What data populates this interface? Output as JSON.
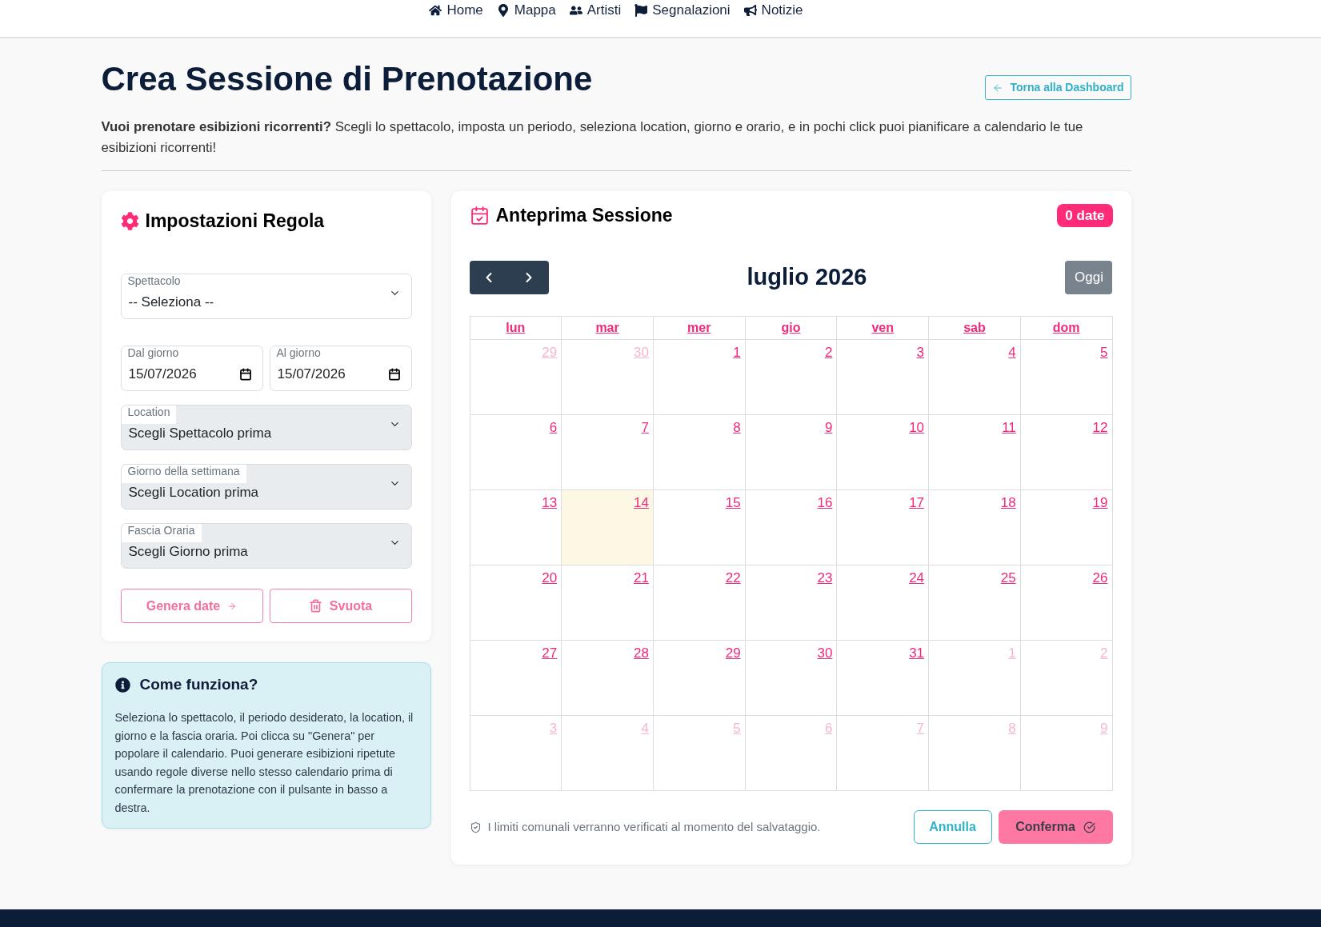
{
  "nav": [
    {
      "label": "Home"
    },
    {
      "label": "Mappa"
    },
    {
      "label": "Artisti"
    },
    {
      "label": "Segnalazioni"
    },
    {
      "label": "Notizie"
    }
  ],
  "page": {
    "title": "Crea Sessione di Prenotazione",
    "back_button": "Torna alla Dashboard",
    "intro": "**Vuoi prenotare esibizioni ricorrenti?** Scegli lo spettacolo, imposta un periodo, seleziona location, giorno e orario, e in pochi click puoi pianificare a calendario le tue esibizioni ricorrenti!"
  },
  "rule_panel": {
    "title": "Impostazioni Regola",
    "fields": [
      {
        "kind": "select",
        "label": "Spettacolo",
        "value": "-- Seleziona --",
        "disabled": false
      },
      {
        "kind": "date",
        "label": "Dal giorno",
        "value": "15/07/2026",
        "disabled": false
      },
      {
        "kind": "date",
        "label": "Al giorno",
        "value": "15/07/2026",
        "disabled": false
      },
      {
        "kind": "select",
        "label": "Location",
        "value": "Scegli Spettacolo prima",
        "disabled": true
      },
      {
        "kind": "select",
        "label": "Giorno della settimana",
        "value": "Scegli Location prima",
        "disabled": true
      },
      {
        "kind": "select",
        "label": "Fascia Oraria",
        "value": "Scegli Giorno prima",
        "disabled": true
      }
    ],
    "buttons": [
      {
        "kind": "generate",
        "label": "Genera date"
      },
      {
        "kind": "clear",
        "label": "Svuota"
      }
    ]
  },
  "info": {
    "title": "Come funziona?",
    "text": "Seleziona lo spettacolo, il periodo desiderato, la location, il giorno e la fascia oraria. Poi clicca su \"Genera\" per popolare il calendario. Puoi generare esibizioni ripetute usando regole diverse nello stesso calendario prima di confermare la prenotazione con il pulsante in basso a destra."
  },
  "preview": {
    "title": "Anteprima Sessione",
    "badge": "0 date",
    "calendar": {
      "month": "luglio 2026",
      "today_button": "Oggi",
      "weekdays": [
        "lun",
        "mar",
        "mer",
        "gio",
        "ven",
        "sab",
        "dom"
      ],
      "days": [
        {
          "day": "29",
          "in_month": false,
          "today": false
        },
        {
          "day": "30",
          "in_month": false,
          "today": false
        },
        {
          "day": "1",
          "in_month": true,
          "today": false
        },
        {
          "day": "2",
          "in_month": true,
          "today": false
        },
        {
          "day": "3",
          "in_month": true,
          "today": false
        },
        {
          "day": "4",
          "in_month": true,
          "today": false
        },
        {
          "day": "5",
          "in_month": true,
          "today": false
        },
        {
          "day": "6",
          "in_month": true,
          "today": false
        },
        {
          "day": "7",
          "in_month": true,
          "today": false
        },
        {
          "day": "8",
          "in_month": true,
          "today": false
        },
        {
          "day": "9",
          "in_month": true,
          "today": false
        },
        {
          "day": "10",
          "in_month": true,
          "today": false
        },
        {
          "day": "11",
          "in_month": true,
          "today": false
        },
        {
          "day": "12",
          "in_month": true,
          "today": false
        },
        {
          "day": "13",
          "in_month": true,
          "today": false
        },
        {
          "day": "14",
          "in_month": true,
          "today": true
        },
        {
          "day": "15",
          "in_month": true,
          "today": false
        },
        {
          "day": "16",
          "in_month": true,
          "today": false
        },
        {
          "day": "17",
          "in_month": true,
          "today": false
        },
        {
          "day": "18",
          "in_month": true,
          "today": false
        },
        {
          "day": "19",
          "in_month": true,
          "today": false
        },
        {
          "day": "20",
          "in_month": true,
          "today": false
        },
        {
          "day": "21",
          "in_month": true,
          "today": false
        },
        {
          "day": "22",
          "in_month": true,
          "today": false
        },
        {
          "day": "23",
          "in_month": true,
          "today": false
        },
        {
          "day": "24",
          "in_month": true,
          "today": false
        },
        {
          "day": "25",
          "in_month": true,
          "today": false
        },
        {
          "day": "26",
          "in_month": true,
          "today": false
        },
        {
          "day": "27",
          "in_month": true,
          "today": false
        },
        {
          "day": "28",
          "in_month": true,
          "today": false
        },
        {
          "day": "29",
          "in_month": true,
          "today": false
        },
        {
          "day": "30",
          "in_month": true,
          "today": false
        },
        {
          "day": "31",
          "in_month": true,
          "today": false
        },
        {
          "day": "1",
          "in_month": false,
          "today": false
        },
        {
          "day": "2",
          "in_month": false,
          "today": false
        },
        {
          "day": "3",
          "in_month": false,
          "today": false
        },
        {
          "day": "4",
          "in_month": false,
          "today": false
        },
        {
          "day": "5",
          "in_month": false,
          "today": false
        },
        {
          "day": "6",
          "in_month": false,
          "today": false
        },
        {
          "day": "7",
          "in_month": false,
          "today": false
        },
        {
          "day": "8",
          "in_month": false,
          "today": false
        },
        {
          "day": "9",
          "in_month": false,
          "today": false
        }
      ]
    },
    "note": "I limiti comunali verranno verificati al momento del salvataggio.",
    "buttons": [
      {
        "kind": "cancel",
        "label": "Annulla"
      },
      {
        "kind": "confirm",
        "label": "Conferma"
      }
    ]
  }
}
